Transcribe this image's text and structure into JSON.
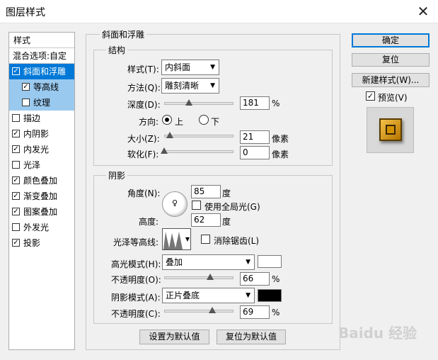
{
  "window": {
    "title": "图层样式",
    "close_glyph": "✕"
  },
  "sidebar": {
    "header": "样式",
    "blend": "混合选项:自定",
    "items": [
      {
        "label": "斜面和浮雕",
        "checked": true
      },
      {
        "label": "等高线",
        "checked": true
      },
      {
        "label": "纹理",
        "checked": false
      },
      {
        "label": "描边",
        "checked": false
      },
      {
        "label": "内阴影",
        "checked": true
      },
      {
        "label": "内发光",
        "checked": true
      },
      {
        "label": "光泽",
        "checked": false
      },
      {
        "label": "颜色叠加",
        "checked": true
      },
      {
        "label": "渐变叠加",
        "checked": true
      },
      {
        "label": "图案叠加",
        "checked": true
      },
      {
        "label": "外发光",
        "checked": false
      },
      {
        "label": "投影",
        "checked": true
      }
    ]
  },
  "bevel": {
    "group_title": "斜面和浮雕",
    "structure": {
      "title": "结构",
      "style_label": "样式(T):",
      "style_value": "内斜面",
      "method_label": "方法(Q):",
      "method_value": "雕刻清晰",
      "depth_label": "深度(D):",
      "depth_value": "181",
      "depth_unit": "%",
      "depth_level": 0.36,
      "direction_label": "方向:",
      "dir_up": "上",
      "dir_down": "下",
      "dir_selected": "上",
      "size_label": "大小(Z):",
      "size_value": "21",
      "size_unit": "像素",
      "size_level": 0.08,
      "soften_label": "软化(F):",
      "soften_value": "0",
      "soften_unit": "像素",
      "soften_level": 0.0
    },
    "shading": {
      "title": "阴影",
      "angle_label": "角度(N):",
      "angle_value": "85",
      "angle_unit": "度",
      "global_light_label": "使用全局光(G)",
      "global_light_checked": false,
      "altitude_label": "高度:",
      "altitude_value": "62",
      "altitude_unit": "度",
      "gloss_label": "光泽等高线:",
      "antialias_label": "消除锯齿(L)",
      "antialias_checked": false,
      "highlight_mode_label": "高光模式(H):",
      "highlight_mode_value": "叠加",
      "highlight_color": "#ffffff",
      "highlight_opacity_label": "不透明度(O):",
      "highlight_opacity_value": "66",
      "highlight_opacity_unit": "%",
      "highlight_opacity_level": 0.66,
      "shadow_mode_label": "阴影模式(A):",
      "shadow_mode_value": "正片叠底",
      "shadow_color": "#000000",
      "shadow_opacity_label": "不透明度(C):",
      "shadow_opacity_value": "69",
      "shadow_opacity_unit": "%",
      "shadow_opacity_level": 0.69
    },
    "make_default": "设置为默认值",
    "reset_default": "复位为默认值"
  },
  "right": {
    "ok": "确定",
    "reset": "复位",
    "new_style": "新建样式(W)...",
    "preview_label": "预览(V)",
    "preview_checked": true
  },
  "watermark": "Baidu 经验"
}
